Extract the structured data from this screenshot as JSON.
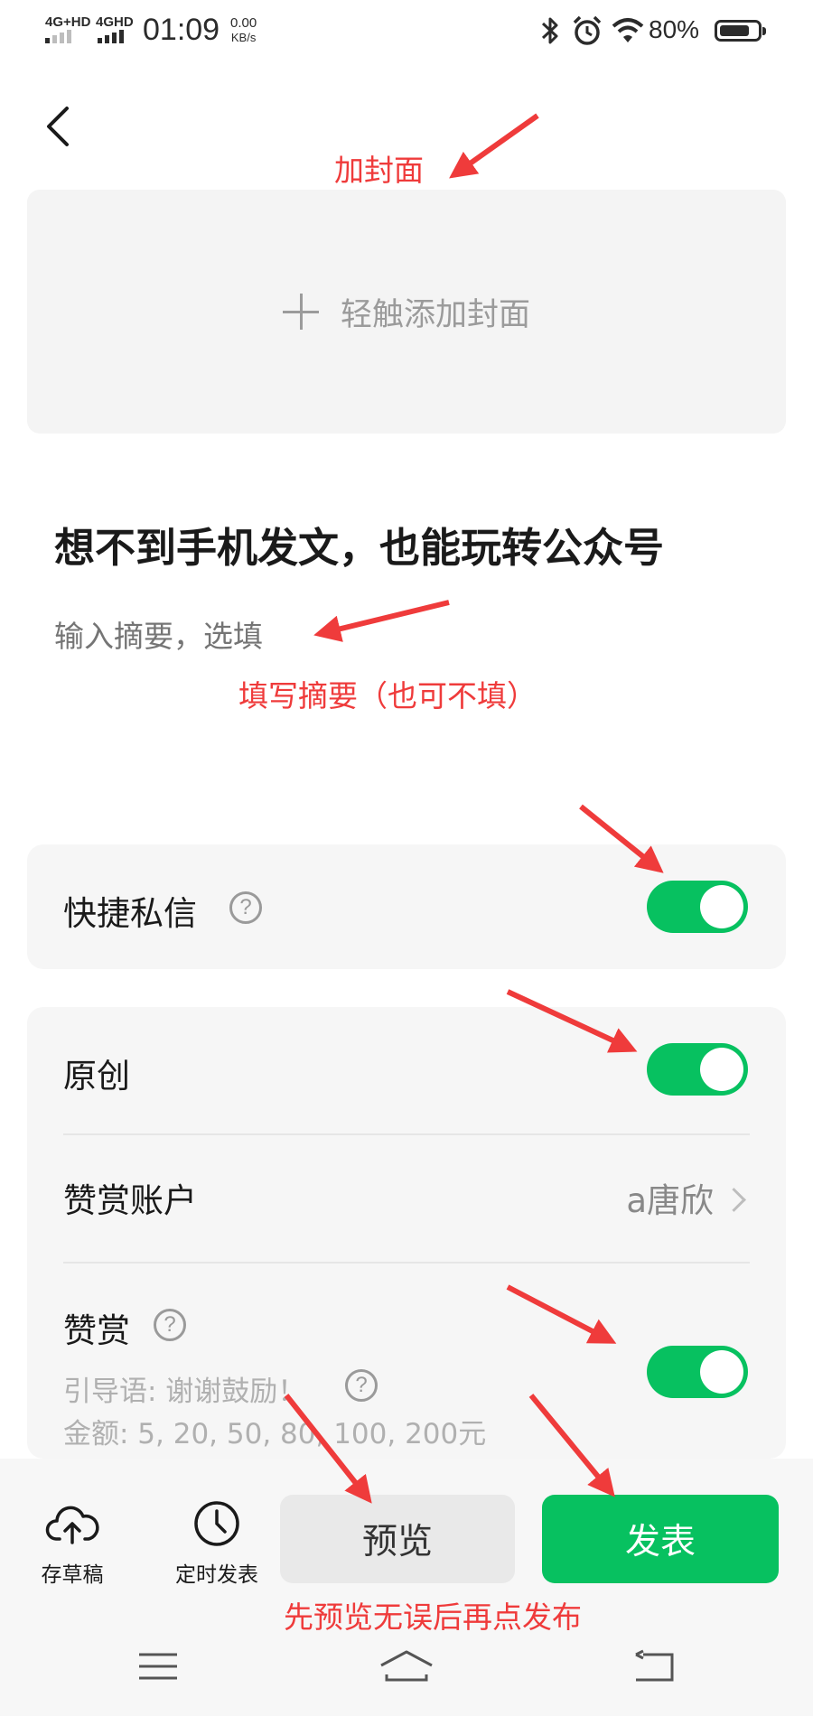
{
  "status_bar": {
    "signal1_label": "4G+HD",
    "signal2_label": "4GHD",
    "time": "01:09",
    "speed_value": "0.00",
    "speed_unit": "KB/s",
    "battery_percent": "80%",
    "battery_level": 0.8,
    "icons": [
      "bluetooth-icon",
      "alarm-icon",
      "wifi-icon",
      "battery-icon"
    ]
  },
  "cover": {
    "add_label": "轻触添加封面"
  },
  "article": {
    "title": "想不到手机发文，也能玩转公众号",
    "summary_placeholder": "输入摘要，选填"
  },
  "settings": {
    "quick_message": {
      "label": "快捷私信",
      "enabled": true
    },
    "original": {
      "label": "原创",
      "enabled": true
    },
    "reward_account": {
      "label": "赞赏账户",
      "value": "a唐欣"
    },
    "reward": {
      "label": "赞赏",
      "enabled": true,
      "guide_text": "引导语: 谢谢鼓励！",
      "amount_text": "金额: 5, 20, 50, 80, 100, 200元"
    }
  },
  "bottom_bar": {
    "save_draft_label": "存草稿",
    "schedule_label": "定时发表",
    "preview_label": "预览",
    "publish_label": "发表"
  },
  "annotations": {
    "cover": "加封面",
    "summary": "填写摘要（也可不填）",
    "publish_tip": "先预览无误后再点发布"
  },
  "colors": {
    "accent_green": "#07c160",
    "annotation_red": "#ef3b3b"
  }
}
